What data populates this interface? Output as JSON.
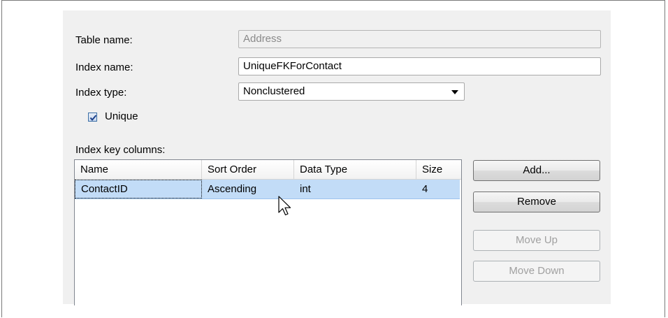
{
  "form": {
    "table_name_label": "Table name:",
    "table_name_value": "Address",
    "index_name_label": "Index name:",
    "index_name_value": "UniqueFKForContact",
    "index_type_label": "Index type:",
    "index_type_value": "Nonclustered",
    "unique_label": "Unique",
    "unique_checked": true,
    "key_columns_label": "Index key columns:"
  },
  "grid": {
    "headers": [
      "Name",
      "Sort Order",
      "Data Type",
      "Size"
    ],
    "rows": [
      [
        "ContactID",
        "Ascending",
        "int",
        "4"
      ]
    ]
  },
  "buttons": {
    "add": "Add...",
    "remove": "Remove",
    "move_up": "Move Up",
    "move_down": "Move Down"
  }
}
